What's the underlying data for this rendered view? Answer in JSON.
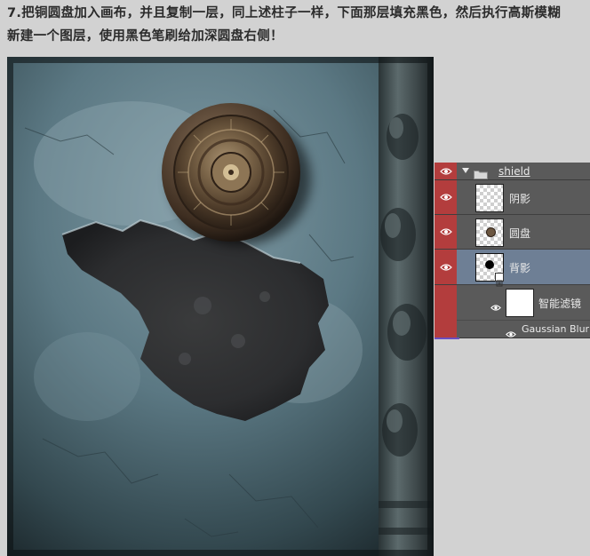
{
  "instruction": {
    "line1": "7.把铜圆盘加入画布，并且复制一层，同上述柱子一样，下面那层填充黑色，然后执行高斯模糊",
    "line2": "新建一个图层，使用黑色笔刷给加深圆盘右侧！"
  },
  "layers_panel": {
    "group": {
      "name": "shield",
      "expanded": true,
      "visible": true
    },
    "layers": [
      {
        "name": "阴影",
        "visible": true,
        "selected": false
      },
      {
        "name": "圆盘",
        "visible": true,
        "selected": false
      },
      {
        "name": "背影",
        "visible": true,
        "selected": true
      }
    ],
    "smart_filters_label": "智能滤镜",
    "filter_name": "Gaussian Blur"
  },
  "colors": {
    "eye_column": "#b33d3d",
    "panel_bg": "#5a5a5a",
    "selected_row": "#6e7f95",
    "page_bg": "#d2d2d2"
  }
}
